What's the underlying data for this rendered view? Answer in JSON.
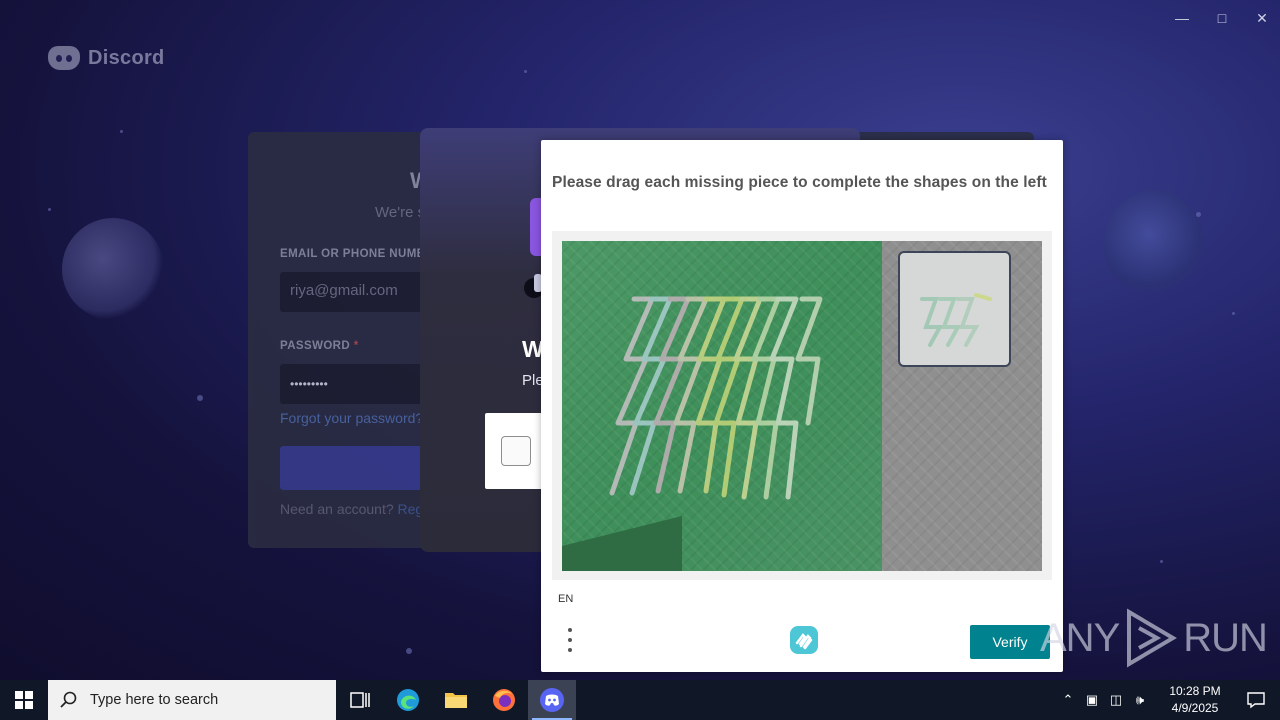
{
  "window": {
    "minimize_icon": "minimize-icon",
    "maximize_icon": "maximize-icon",
    "close_icon": "close-icon"
  },
  "brand": {
    "name": "Discord"
  },
  "login": {
    "heading": "W",
    "subheading": "We're s",
    "email_label": "EMAIL OR PHONE NUMBE",
    "email_value": "riya@gmail.com",
    "password_label": "PASSWORD",
    "required_mark": "*",
    "password_value": "•••••••••",
    "forgot_link": "Forgot your password?",
    "need_account_text": "Need an account?",
    "register_link": "Regis"
  },
  "modal": {
    "title": "W",
    "subtitle": "Ple"
  },
  "captcha": {
    "prompt": "Please drag each missing piece to complete the shapes on the left",
    "language": "EN",
    "verify_label": "Verify",
    "colors": {
      "verify": "#00838f"
    }
  },
  "watermark": {
    "text": "ANY",
    "text2": "RUN"
  },
  "taskbar": {
    "search_placeholder": "Type here to search",
    "apps": [
      "task-view-icon",
      "edge-icon",
      "file-explorer-icon",
      "firefox-icon",
      "discord-icon"
    ],
    "time": "10:28 PM",
    "date": "4/9/2025"
  }
}
